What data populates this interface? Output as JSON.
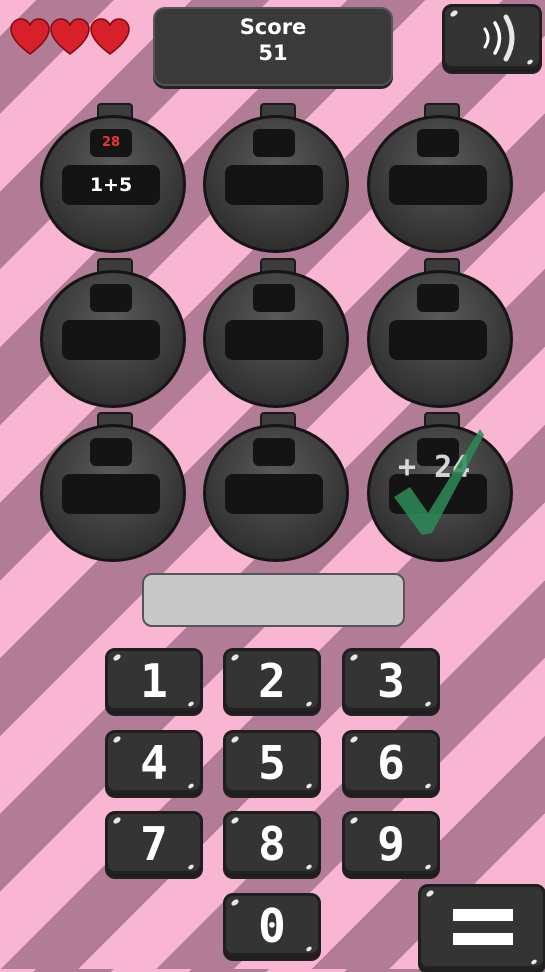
{
  "lives": {
    "count": 3,
    "color": "#d8202a"
  },
  "score": {
    "label": "Score",
    "value": "51"
  },
  "sound": {
    "icon": "sound-waves-icon"
  },
  "timers": [
    {
      "timer_value": "28",
      "expression": "1+5"
    },
    {
      "timer_value": "",
      "expression": ""
    },
    {
      "timer_value": "",
      "expression": ""
    },
    {
      "timer_value": "",
      "expression": ""
    },
    {
      "timer_value": "",
      "expression": ""
    },
    {
      "timer_value": "",
      "expression": ""
    },
    {
      "timer_value": "",
      "expression": ""
    },
    {
      "timer_value": "",
      "expression": ""
    },
    {
      "timer_value": "",
      "expression": "",
      "bonus": "+ 24",
      "solved": true
    }
  ],
  "answer": {
    "value": ""
  },
  "keypad": {
    "keys": [
      "1",
      "2",
      "3",
      "4",
      "5",
      "6",
      "7",
      "8",
      "9",
      "0"
    ]
  },
  "menu": {
    "icon": "menu-icon"
  },
  "colors": {
    "stripe_dark": "#b27c96",
    "stripe_light": "#f8b6d2",
    "check": "#2e8b57"
  }
}
